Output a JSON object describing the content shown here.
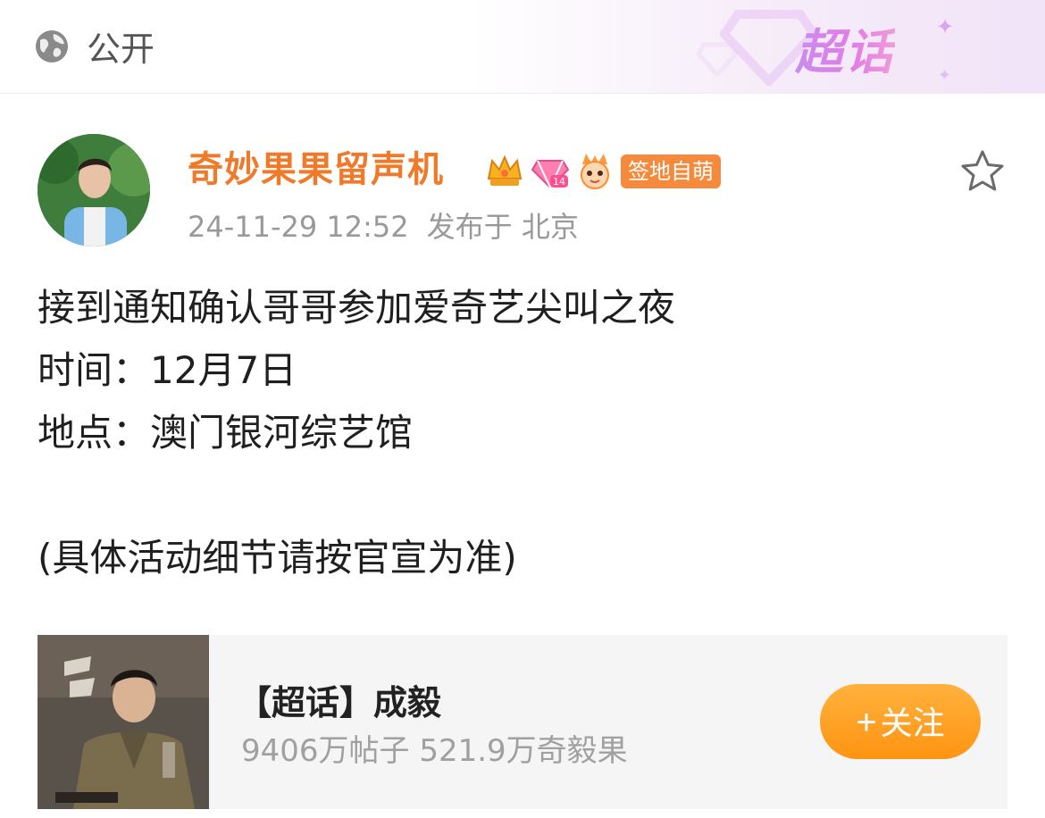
{
  "header": {
    "visibility_icon": "globe-icon",
    "visibility_label": "公开",
    "super_topic_logo": "超话"
  },
  "post": {
    "author": {
      "name": "奇妙果果留声机",
      "badges": [
        "crown-badge-icon",
        "diamond-level-badge-icon",
        "mascot-badge-icon"
      ],
      "tag": "签地自萌"
    },
    "timestamp": "24-11-29 12:52",
    "location": "发布于 北京",
    "bookmark_icon": "star-outline-icon",
    "lines": [
      "接到通知确认哥哥参加爱奇艺尖叫之夜",
      "时间：12月7日",
      "地点：澳门银河综艺馆",
      "",
      "(具体活动细节请按官宣为准)"
    ]
  },
  "topic_card": {
    "title": "【超话】成毅",
    "stats": "9406万帖子 521.9万奇毅果",
    "follow_label": "关注",
    "follow_icon": "plus-icon",
    "colors": {
      "button": "#ff9a1a",
      "username": "#f07a2a"
    }
  }
}
